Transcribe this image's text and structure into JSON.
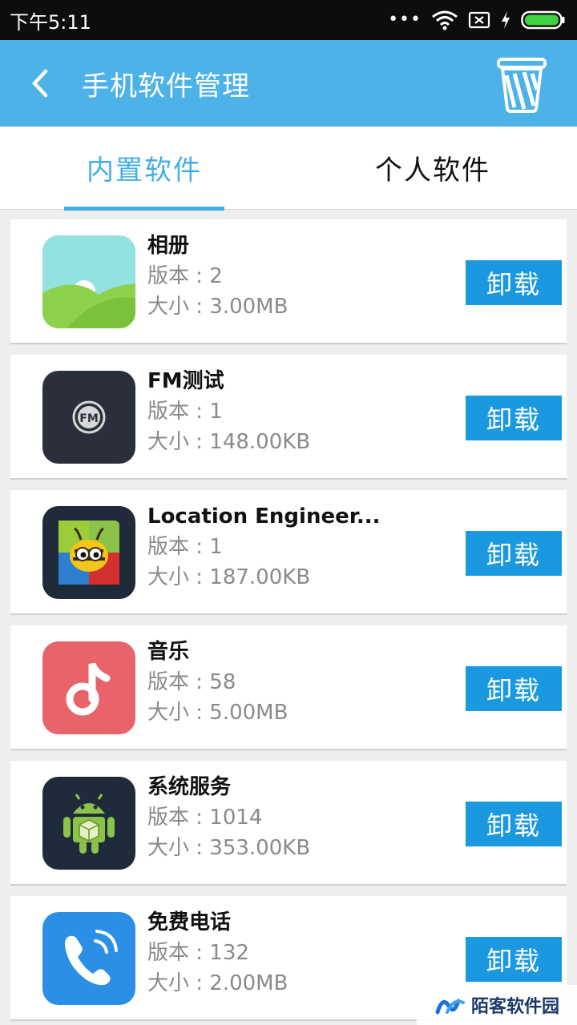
{
  "status": {
    "time": "下午5:11",
    "dots": "•••"
  },
  "header": {
    "title": "手机软件管理"
  },
  "tabs": [
    {
      "label": "内置软件",
      "active": true
    },
    {
      "label": "个人软件",
      "active": false
    }
  ],
  "apps": [
    {
      "name": "相册",
      "version": "版本 : 2",
      "size": "大小 : 3.00MB",
      "button": "卸载",
      "icon": "gallery-icon"
    },
    {
      "name": "FM测试",
      "version": "版本 : 1",
      "size": "大小 : 148.00KB",
      "button": "卸载",
      "icon": "fm-radio-icon"
    },
    {
      "name": "Location Engineer...",
      "version": "版本 : 1",
      "size": "大小 : 187.00KB",
      "button": "卸载",
      "icon": "bee-icon"
    },
    {
      "name": "音乐",
      "version": "版本 : 58",
      "size": "大小 : 5.00MB",
      "button": "卸载",
      "icon": "music-note-icon"
    },
    {
      "name": "系统服务",
      "version": "版本 : 1014",
      "size": "大小 : 353.00KB",
      "button": "卸载",
      "icon": "android-robot-icon"
    },
    {
      "name": "免费电话",
      "version": "版本 : 132",
      "size": "大小 : 2.00MB",
      "button": "卸载",
      "icon": "phone-call-icon"
    }
  ],
  "watermark": {
    "text": "陌客软件园"
  },
  "colors": {
    "primary": "#4cb2e8",
    "button": "#1a98e0",
    "accent": "#45aee8"
  }
}
